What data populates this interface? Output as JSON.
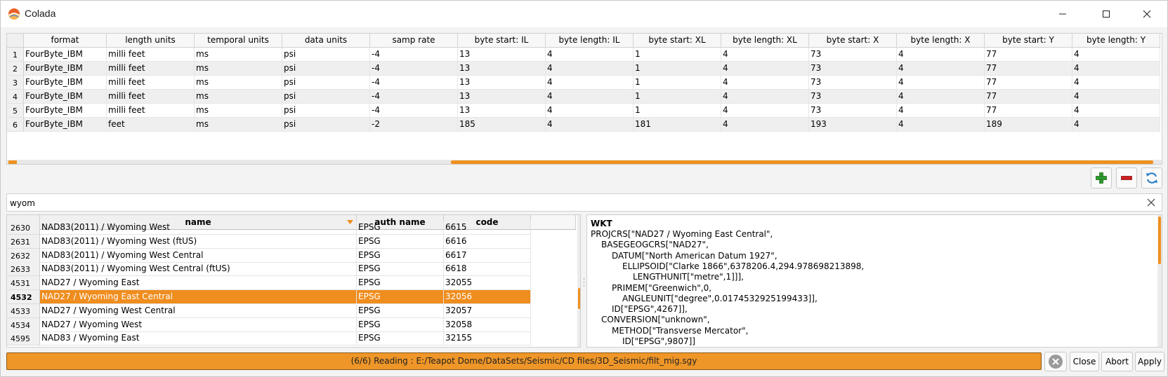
{
  "window": {
    "title": "Colada",
    "controls": [
      "minimize",
      "maximize",
      "close"
    ]
  },
  "top_table": {
    "columns": [
      "format",
      "length units",
      "temporal units",
      "data units",
      "samp rate",
      "byte start: IL",
      "byte length: IL",
      "byte start: XL",
      "byte length: XL",
      "byte start: X",
      "byte length: X",
      "byte start: Y",
      "byte length: Y"
    ],
    "rows": [
      {
        "num": "1",
        "cells": [
          "FourByte_IBM",
          "milli feet",
          "ms",
          "psi",
          "-4",
          "13",
          "4",
          "1",
          "4",
          "73",
          "4",
          "77",
          "4"
        ]
      },
      {
        "num": "2",
        "cells": [
          "FourByte_IBM",
          "milli feet",
          "ms",
          "psi",
          "-4",
          "13",
          "4",
          "1",
          "4",
          "73",
          "4",
          "77",
          "4"
        ]
      },
      {
        "num": "3",
        "cells": [
          "FourByte_IBM",
          "milli feet",
          "ms",
          "psi",
          "-4",
          "13",
          "4",
          "1",
          "4",
          "73",
          "4",
          "77",
          "4"
        ]
      },
      {
        "num": "4",
        "cells": [
          "FourByte_IBM",
          "milli feet",
          "ms",
          "psi",
          "-4",
          "13",
          "4",
          "1",
          "4",
          "73",
          "4",
          "77",
          "4"
        ]
      },
      {
        "num": "5",
        "cells": [
          "FourByte_IBM",
          "milli feet",
          "ms",
          "psi",
          "-4",
          "13",
          "4",
          "1",
          "4",
          "73",
          "4",
          "77",
          "4"
        ]
      },
      {
        "num": "6",
        "cells": [
          "FourByte_IBM",
          "feet",
          "ms",
          "psi",
          "-2",
          "185",
          "4",
          "181",
          "4",
          "193",
          "4",
          "189",
          "4"
        ]
      }
    ]
  },
  "actions": {
    "add_icon": "plus-icon",
    "remove_icon": "minus-icon",
    "refresh_icon": "refresh-icon",
    "colors": {
      "add": "#2e9a2e",
      "remove": "#cc1f1f",
      "refresh": "#2a7fc9"
    }
  },
  "search": {
    "value": "wyom",
    "clear_icon": "close-icon"
  },
  "crs_table": {
    "columns": [
      "name",
      "auth name",
      "code"
    ],
    "sort_column": "name",
    "rows": [
      {
        "num": "2630",
        "name": "NAD83(2011) / Wyoming West",
        "auth": "EPSG",
        "code": "6615",
        "selected": false
      },
      {
        "num": "2631",
        "name": "NAD83(2011) / Wyoming West (ftUS)",
        "auth": "EPSG",
        "code": "6616",
        "selected": false
      },
      {
        "num": "2632",
        "name": "NAD83(2011) / Wyoming West Central",
        "auth": "EPSG",
        "code": "6617",
        "selected": false
      },
      {
        "num": "2633",
        "name": "NAD83(2011) / Wyoming West Central (ftUS)",
        "auth": "EPSG",
        "code": "6618",
        "selected": false
      },
      {
        "num": "4531",
        "name": "NAD27 / Wyoming East",
        "auth": "EPSG",
        "code": "32055",
        "selected": false
      },
      {
        "num": "4532",
        "name": "NAD27 / Wyoming East Central",
        "auth": "EPSG",
        "code": "32056",
        "selected": true
      },
      {
        "num": "4533",
        "name": "NAD27 / Wyoming West Central",
        "auth": "EPSG",
        "code": "32057",
        "selected": false
      },
      {
        "num": "4534",
        "name": "NAD27 / Wyoming West",
        "auth": "EPSG",
        "code": "32058",
        "selected": false
      },
      {
        "num": "4595",
        "name": "NAD83 / Wyoming East",
        "auth": "EPSG",
        "code": "32155",
        "selected": false
      }
    ],
    "accent": "#ef8d1e"
  },
  "wkt": {
    "title": "WKT",
    "lines": [
      {
        "indent": 0,
        "text": "PROJCRS[\"NAD27 / Wyoming East Central\","
      },
      {
        "indent": 1,
        "text": "BASEGEOGCRS[\"NAD27\","
      },
      {
        "indent": 2,
        "text": "DATUM[\"North American Datum 1927\","
      },
      {
        "indent": 3,
        "text": "ELLIPSOID[\"Clarke 1866\",6378206.4,294.978698213898,"
      },
      {
        "indent": 4,
        "text": "LENGTHUNIT[\"metre\",1]]],"
      },
      {
        "indent": 2,
        "text": "PRIMEM[\"Greenwich\",0,"
      },
      {
        "indent": 3,
        "text": "ANGLEUNIT[\"degree\",0.0174532925199433]],"
      },
      {
        "indent": 2,
        "text": "ID[\"EPSG\",4267]],"
      },
      {
        "indent": 1,
        "text": "CONVERSION[\"unknown\","
      },
      {
        "indent": 2,
        "text": "METHOD[\"Transverse Mercator\","
      },
      {
        "indent": 3,
        "text": "ID[\"EPSG\",9807]]"
      }
    ]
  },
  "status": {
    "progress_text": "(6/6) Reading : E:/Teapot Dome/DataSets/Seismic/CD files/3D_Seismic/filt_mig.sgy",
    "progress_fraction": 1.0,
    "progress_color": "#ef9628",
    "stop_icon": "stop-icon",
    "close_label": "Close",
    "abort_label": "Abort",
    "apply_label": "Apply"
  }
}
